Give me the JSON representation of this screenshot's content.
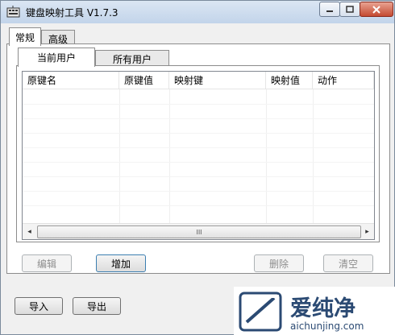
{
  "window": {
    "title": "键盘映射工具 V1.7.3"
  },
  "outer_tabs": [
    {
      "label": "常规",
      "active": true
    },
    {
      "label": "高级",
      "active": false
    }
  ],
  "inner_tabs": [
    {
      "label": "当前用户",
      "active": true
    },
    {
      "label": "所有用户",
      "active": false
    }
  ],
  "table": {
    "columns": [
      "原键名",
      "原键值",
      "映射键",
      "映射值",
      "动作"
    ],
    "rows": []
  },
  "scrollbar": {
    "left": "◂",
    "right": "▸",
    "grip": "III"
  },
  "buttons": {
    "edit": "编辑",
    "add": "增加",
    "delete": "删除",
    "clear": "清空",
    "import": "导入",
    "export": "导出"
  },
  "watermark": {
    "brand": "爱纯净",
    "url": "aichunjing.com"
  },
  "colors": {
    "titlebar": "#c9d9ee",
    "close": "#c75036",
    "panel": "#ffffff"
  }
}
